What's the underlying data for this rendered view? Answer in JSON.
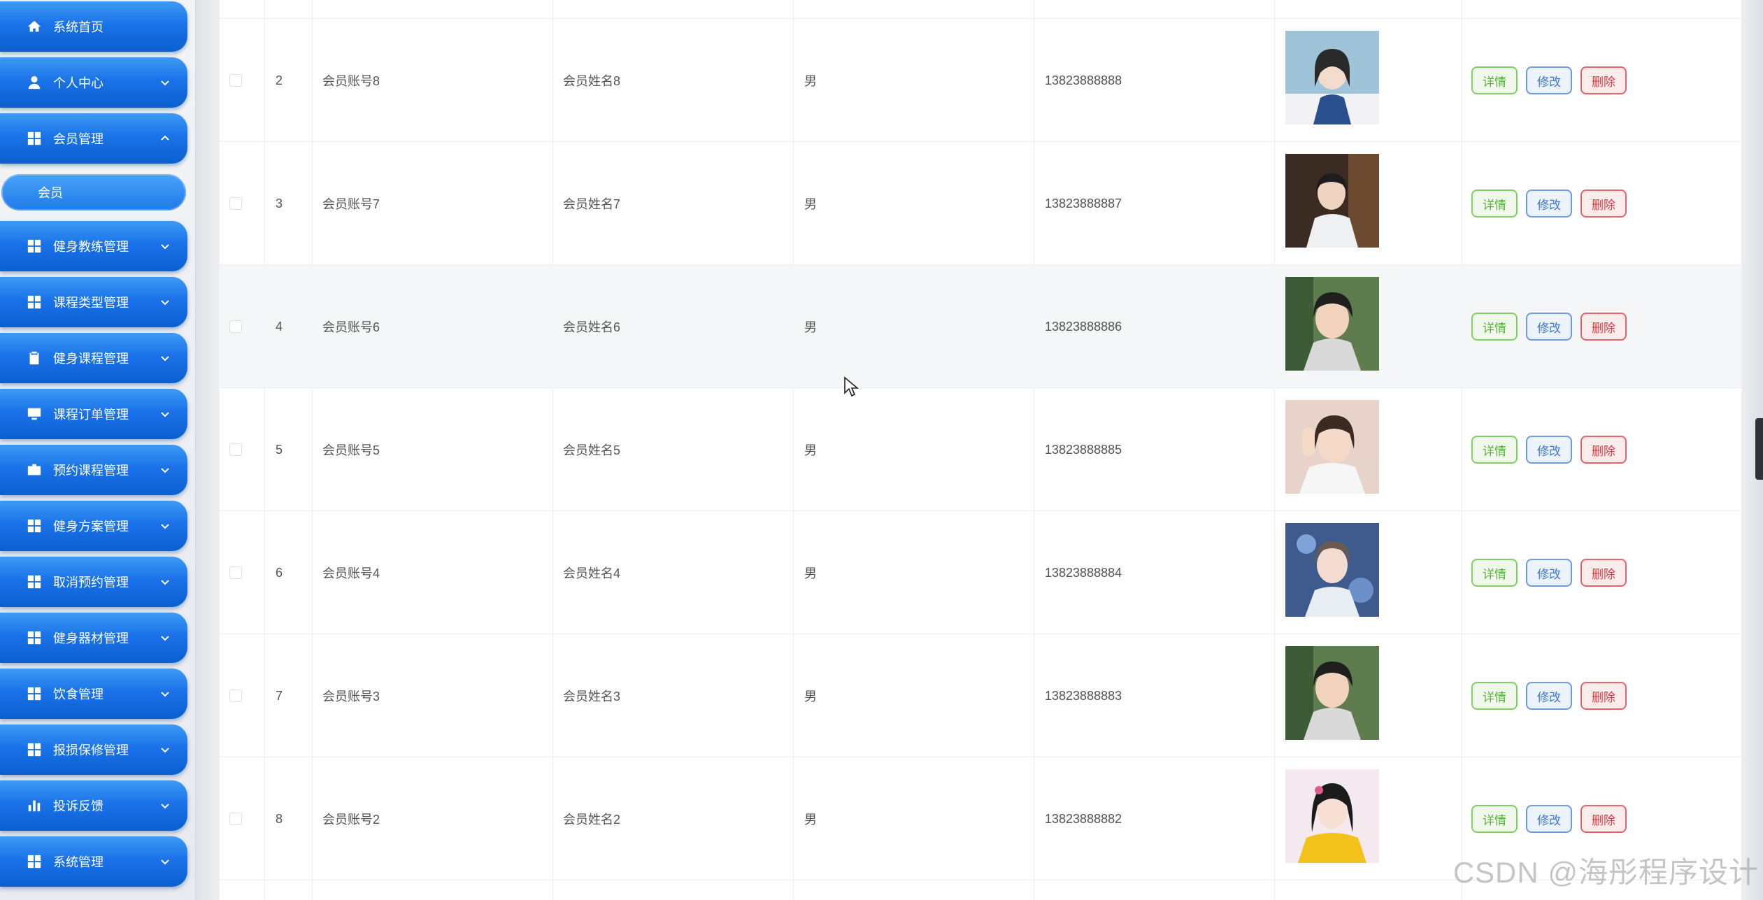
{
  "sidebar": {
    "items": [
      {
        "label": "系统首页",
        "icon": "home-icon",
        "has_chevron": false
      },
      {
        "label": "个人中心",
        "icon": "user-icon",
        "has_chevron": true
      },
      {
        "label": "会员管理",
        "icon": "grid-icon",
        "has_chevron": true,
        "expanded": true
      },
      {
        "label": "健身教练管理",
        "icon": "grid-icon",
        "has_chevron": true
      },
      {
        "label": "课程类型管理",
        "icon": "grid-icon",
        "has_chevron": true
      },
      {
        "label": "健身课程管理",
        "icon": "clipboard-icon",
        "has_chevron": true
      },
      {
        "label": "课程订单管理",
        "icon": "monitor-icon",
        "has_chevron": true
      },
      {
        "label": "预约课程管理",
        "icon": "briefcase-icon",
        "has_chevron": true
      },
      {
        "label": "健身方案管理",
        "icon": "grid-icon",
        "has_chevron": true
      },
      {
        "label": "取消预约管理",
        "icon": "grid-icon",
        "has_chevron": true
      },
      {
        "label": "健身器材管理",
        "icon": "grid-icon",
        "has_chevron": true
      },
      {
        "label": "饮食管理",
        "icon": "grid-icon",
        "has_chevron": true
      },
      {
        "label": "报损保修管理",
        "icon": "grid-icon",
        "has_chevron": true
      },
      {
        "label": "投诉反馈",
        "icon": "bar-chart-icon",
        "has_chevron": true
      },
      {
        "label": "系统管理",
        "icon": "grid-icon",
        "has_chevron": true
      }
    ],
    "submenu": {
      "label": "会员"
    }
  },
  "table": {
    "rows": [
      {
        "index": "2",
        "account": "会员账号8",
        "name": "会员姓名8",
        "gender": "男",
        "phone": "13823888888",
        "avatar": "avatar-girl-uniform"
      },
      {
        "index": "3",
        "account": "会员账号7",
        "name": "会员姓名7",
        "gender": "男",
        "phone": "13823888887",
        "avatar": "avatar-boy-white-shirt"
      },
      {
        "index": "4",
        "account": "会员账号6",
        "name": "会员姓名6",
        "gender": "男",
        "phone": "13823888886",
        "avatar": "avatar-boy-hoodie"
      },
      {
        "index": "5",
        "account": "会员账号5",
        "name": "会员姓名5",
        "gender": "男",
        "phone": "13823888885",
        "avatar": "avatar-girl-hand"
      },
      {
        "index": "6",
        "account": "会员账号4",
        "name": "会员姓名4",
        "gender": "男",
        "phone": "13823888884",
        "avatar": "avatar-boy-blue"
      },
      {
        "index": "7",
        "account": "会员账号3",
        "name": "会员姓名3",
        "gender": "男",
        "phone": "13823888883",
        "avatar": "avatar-boy-hoodie"
      },
      {
        "index": "8",
        "account": "会员账号2",
        "name": "会员姓名2",
        "gender": "男",
        "phone": "13823888882",
        "avatar": "avatar-girl-yellow"
      }
    ],
    "highlighted_row": "4",
    "actions": {
      "detail": "详情",
      "edit": "修改",
      "delete": "删除"
    }
  },
  "watermark": "CSDN @海彤程序设计",
  "colors": {
    "menu_blue": "#1a73e8",
    "detail_green": "#5aaf3e",
    "edit_blue": "#3b78cf",
    "delete_red": "#d93d44"
  }
}
